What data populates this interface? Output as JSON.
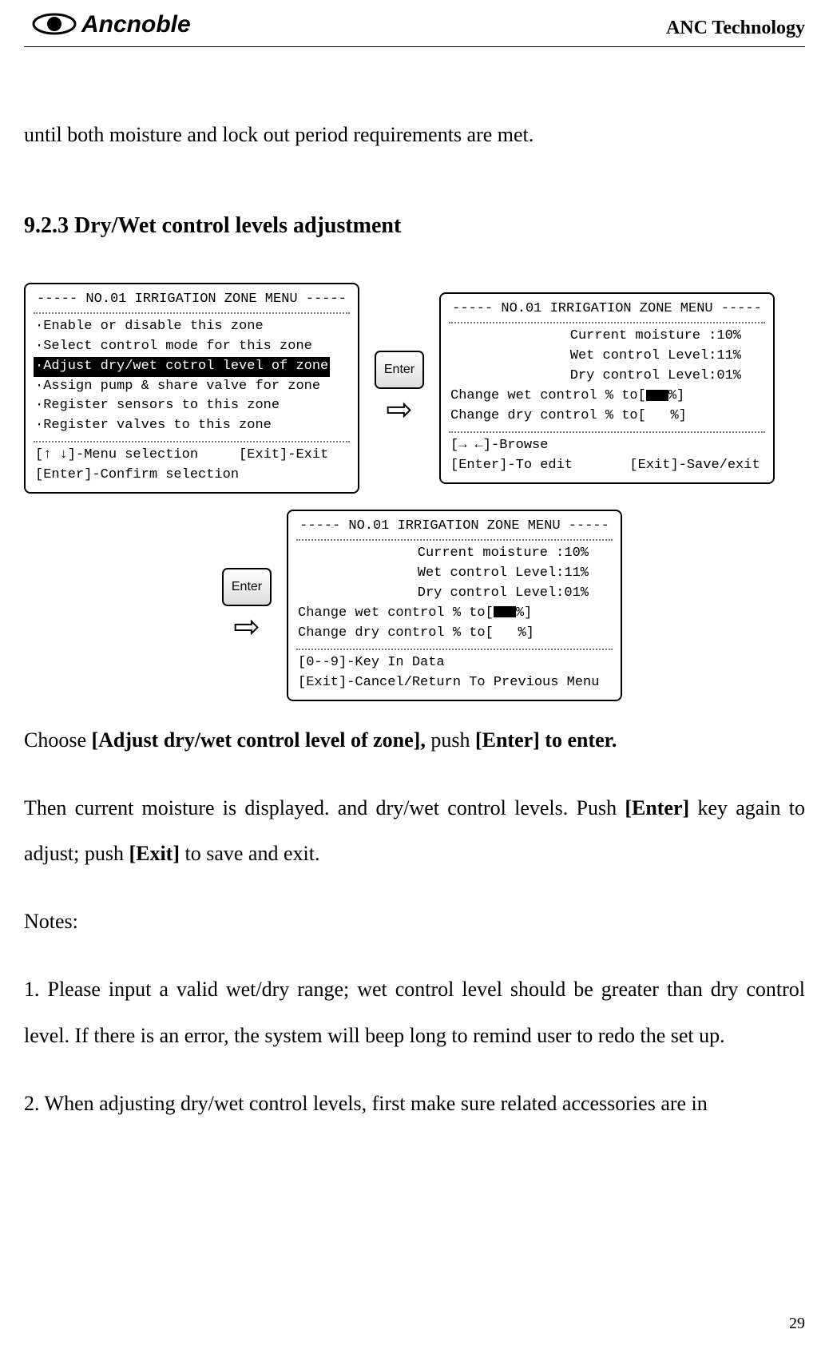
{
  "header": {
    "brand": "Ancnoble",
    "right": "ANC Technology"
  },
  "intro_line": "until both moisture and lock out period requirements are met.",
  "section_heading": "9.2.3 Dry/Wet control levels adjustment",
  "enter_label": "Enter",
  "arrow_glyph": "⇨",
  "screen1": {
    "title": "----- NO.01 IRRIGATION ZONE MENU -----",
    "items": [
      "·Enable or disable this zone",
      "·Select control mode for this zone",
      "·Adjust dry/wet cotrol level of zone",
      "·Assign pump & share valve for zone",
      "·Register sensors to this zone",
      "·Register valves to this zone"
    ],
    "footer1": "[↑ ↓]-Menu selection     [Exit]-Exit",
    "footer2": "[Enter]-Confirm selection"
  },
  "screen2": {
    "title": "----- NO.01 IRRIGATION ZONE MENU -----",
    "lines": {
      "l1": "Current moisture :10%",
      "l2": "Wet control Level:11%",
      "l3": "Dry control Level:01%",
      "l4a": "Change wet control % to[",
      "l4b": "%]",
      "l5": "Change dry control % to[   %]"
    },
    "footer1": "[→ ←]-Browse",
    "footer2": "[Enter]-To edit       [Exit]-Save/exit"
  },
  "screen3": {
    "title": "----- NO.01 IRRIGATION ZONE MENU -----",
    "lines": {
      "l1": "Current moisture :10%",
      "l2": "Wet control Level:11%",
      "l3": "Dry control Level:01%",
      "l4a": "Change wet control % to[",
      "l4b": "%]",
      "l5": "Change dry control % to[   %]"
    },
    "footer1": "[0--9]-Key In Data",
    "footer2": "[Exit]-Cancel/Return To Previous Menu"
  },
  "p2_pre": "Choose ",
  "p2_b1": "[Adjust dry/wet control level of zone],",
  "p2_mid": " push ",
  "p2_b2": "[Enter] to enter.",
  "p3_pre": "Then current moisture is displayed. and dry/wet control levels. Push ",
  "p3_b1": "[Enter]",
  "p3_mid": " key again to adjust; push ",
  "p3_b2": "[Exit]",
  "p3_post": " to save and exit.",
  "notes_label": "Notes:",
  "note1": "1. Please input a valid wet/dry range; wet control level should be greater than dry control level. If there is an error, the system will beep long to remind user to redo the set up.",
  "note2": "2. When adjusting dry/wet control levels, first make sure related accessories are in",
  "page_number": "29"
}
